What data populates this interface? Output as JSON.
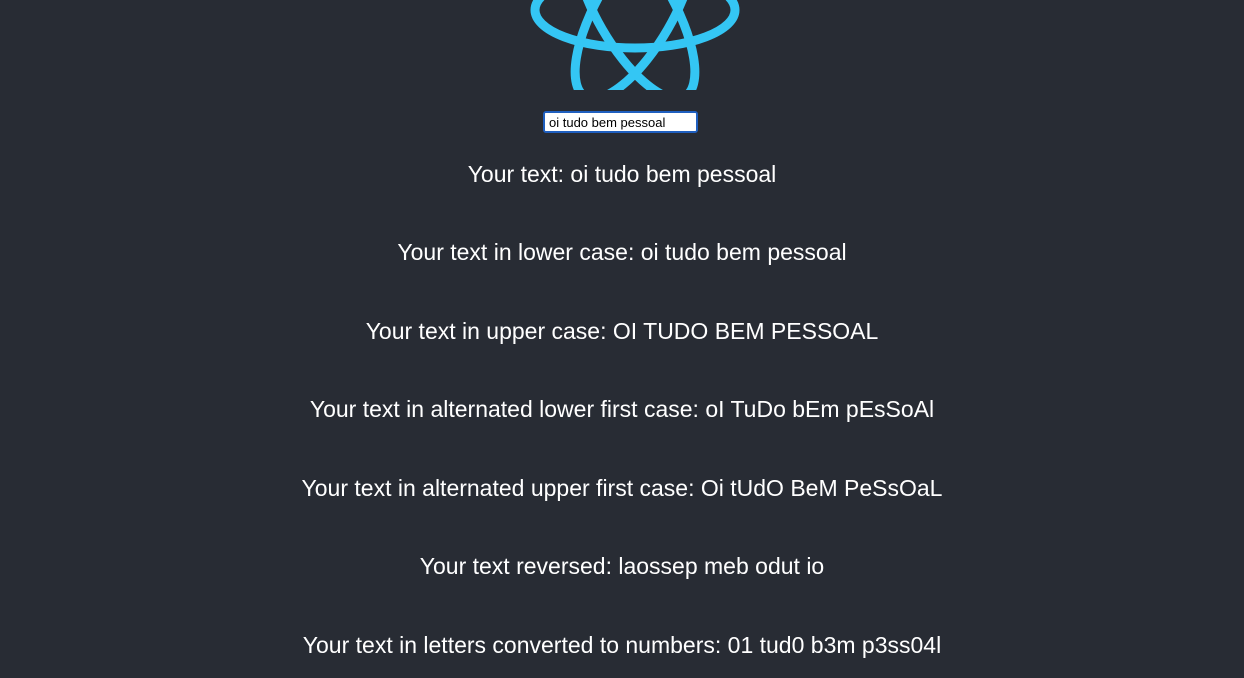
{
  "logo": {
    "icon": "react-atom-icon",
    "color": "#61dafb"
  },
  "input": {
    "value": "oi tudo bem pessoal"
  },
  "results": [
    {
      "label": "Your text: ",
      "value": "oi tudo bem pessoal"
    },
    {
      "label": "Your text in lower case: ",
      "value": "oi tudo bem pessoal"
    },
    {
      "label": "Your text in upper case: ",
      "value": "OI TUDO BEM PESSOAL"
    },
    {
      "label": "Your text in alternated lower first case: ",
      "value": "oI TuDo bEm pEsSoAl"
    },
    {
      "label": "Your text in alternated upper first case: ",
      "value": "Oi tUdO BeM PeSsOaL"
    },
    {
      "label": "Your text reversed: ",
      "value": "laossep meb odut io"
    },
    {
      "label": "Your text in letters converted to numbers: ",
      "value": "01 tud0 b3m p3ss04l"
    }
  ]
}
